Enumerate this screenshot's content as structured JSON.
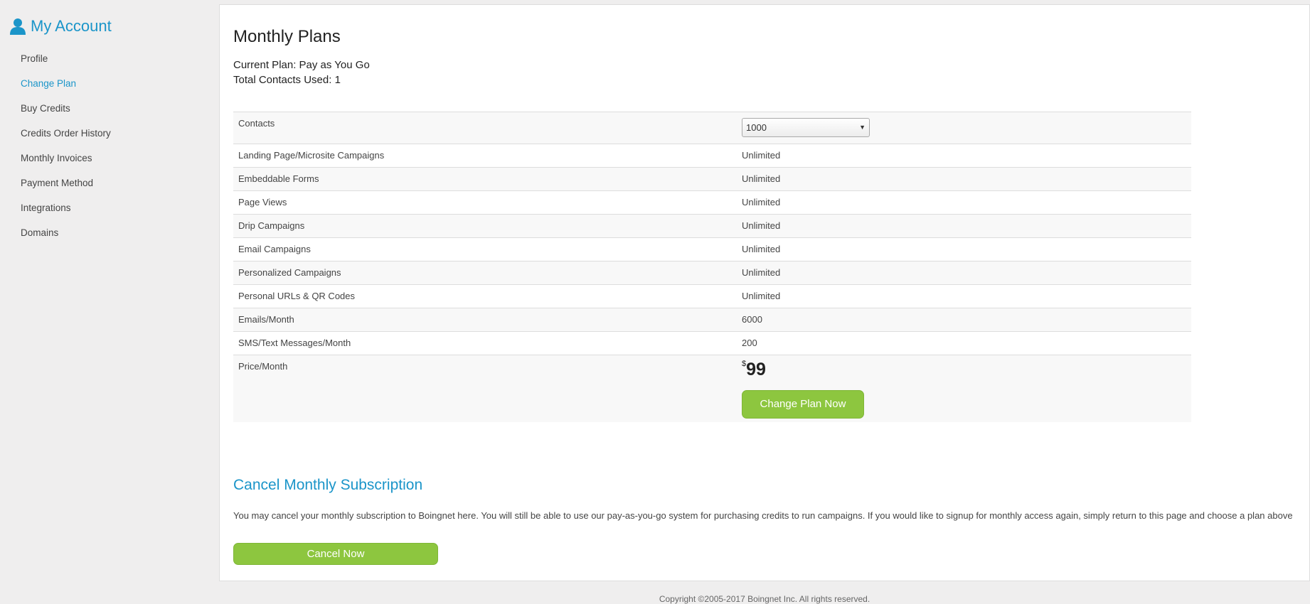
{
  "sidebar": {
    "title": "My Account",
    "items": [
      {
        "label": "Profile",
        "active": false
      },
      {
        "label": "Change Plan",
        "active": true
      },
      {
        "label": "Buy Credits",
        "active": false
      },
      {
        "label": "Credits Order History",
        "active": false
      },
      {
        "label": "Monthly Invoices",
        "active": false
      },
      {
        "label": "Payment Method",
        "active": false
      },
      {
        "label": "Integrations",
        "active": false
      },
      {
        "label": "Domains",
        "active": false
      }
    ]
  },
  "main": {
    "title": "Monthly Plans",
    "current_plan": "Current Plan: Pay as You Go",
    "contacts_used": "Total Contacts Used: 1",
    "table": {
      "contacts_label": "Contacts",
      "contacts_selected": "1000",
      "rows": [
        {
          "label": "Landing Page/Microsite Campaigns",
          "value": "Unlimited"
        },
        {
          "label": "Embeddable Forms",
          "value": "Unlimited"
        },
        {
          "label": "Page Views",
          "value": "Unlimited"
        },
        {
          "label": "Drip Campaigns",
          "value": "Unlimited"
        },
        {
          "label": "Email Campaigns",
          "value": "Unlimited"
        },
        {
          "label": "Personalized Campaigns",
          "value": "Unlimited"
        },
        {
          "label": "Personal URLs & QR Codes",
          "value": "Unlimited"
        },
        {
          "label": "Emails/Month",
          "value": "6000"
        },
        {
          "label": "SMS/Text Messages/Month",
          "value": "200"
        }
      ],
      "price_label": "Price/Month",
      "price_currency": "$",
      "price_amount": "99",
      "change_button": "Change Plan Now"
    },
    "cancel": {
      "title": "Cancel Monthly Subscription",
      "text": "You may cancel your monthly subscription to Boingnet here. You will still be able to use our pay-as-you-go system for purchasing credits to run campaigns. If you would like to signup for monthly access again, simply return to this page and choose a plan above",
      "button": "Cancel Now"
    }
  },
  "footer": {
    "text": "Copyright ©2005-2017 Boingnet Inc. All rights reserved."
  },
  "colors": {
    "accent": "#1b95c9",
    "button_green": "#8dc63f",
    "page_bg": "#efeeee"
  },
  "icons": {
    "sidebar_title": "user-icon",
    "select_arrow": "caret-down-icon"
  }
}
